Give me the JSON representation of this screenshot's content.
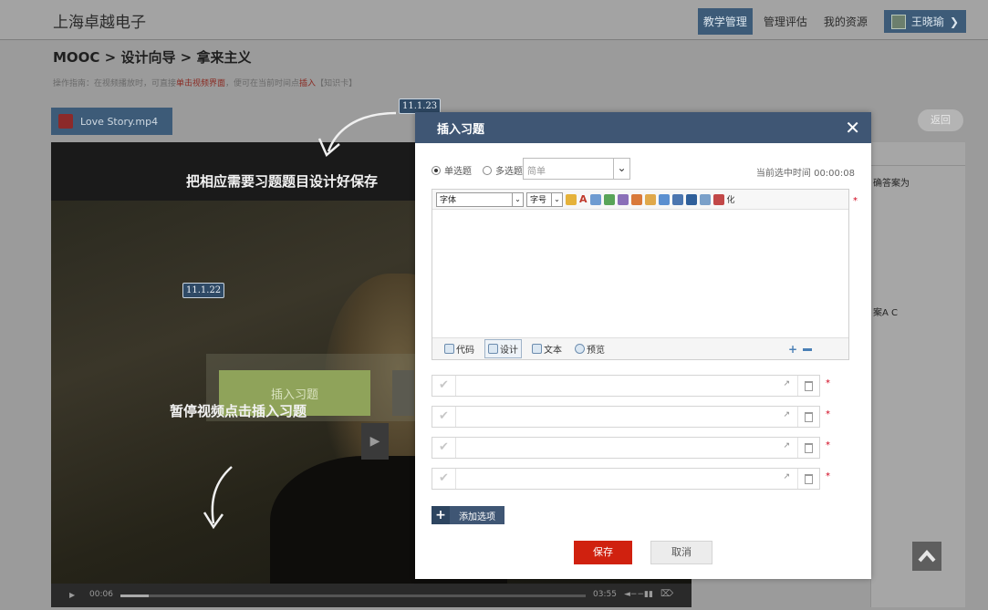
{
  "header": {
    "logo": "上海卓越电子",
    "nav": [
      "教学管理",
      "管理评估",
      "我的资源"
    ],
    "user": "王晓瑜"
  },
  "breadcrumb": "MOOC > 设计向导 > 拿来主义",
  "hint": {
    "prefix": "操作指南：在视频播放时，可直接",
    "hl1": "单击视频界面",
    "mid": "，便可在当前时间点",
    "hl2": "插入",
    "suffix": "【知识卡】"
  },
  "file_tab": "Love Story.mp4",
  "back_button": "返回",
  "right_panel": {
    "text1": "确答案为",
    "text2": "案A C"
  },
  "video": {
    "caption_top": "把相应需要习题题目设计好保存",
    "caption_bottom": "暂停视频点击插入习题",
    "tag_top": "11.1.23",
    "tag_bottom": "11.1.22",
    "insert_button": "插入习题",
    "time_current": "00:06",
    "time_total": "03:55",
    "progress": 0.06
  },
  "modal": {
    "title": "插入习题",
    "close": "✕",
    "radio_single": "单选题",
    "radio_multi": "多选题",
    "difficulty": "简单",
    "current_time": "当前选中时间 00:00:08",
    "toolbar": {
      "font": "字体",
      "size": "字号",
      "last": "化"
    },
    "modes": [
      "代码",
      "设计",
      "文本",
      "预览"
    ],
    "add_option": "添加选项",
    "save": "保存",
    "cancel": "取消",
    "required_mark": "*"
  }
}
